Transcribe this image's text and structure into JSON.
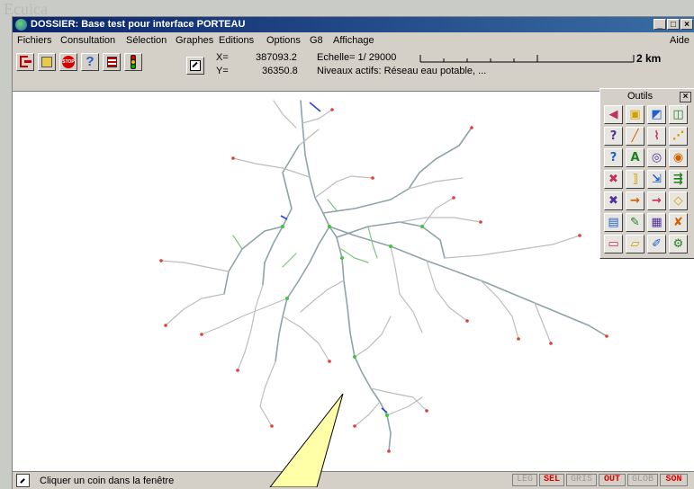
{
  "window": {
    "title": "DOSSIER: Base test pour interface PORTEAU",
    "buttons": [
      "_",
      "□",
      "×"
    ]
  },
  "menu": {
    "items": [
      "Fichiers",
      "Consultation",
      "Sélection",
      "Graphes",
      "Editions",
      "Options",
      "G8",
      "Affichage"
    ],
    "help": "Aide"
  },
  "coords": {
    "x_label": "X=",
    "x_value": "387093.2",
    "y_label": "Y=",
    "y_value": "36350.8"
  },
  "scale": {
    "label": "Echelle= 1/ 29000",
    "levels": "Niveaux actifs:  Réseau eau potable, ...",
    "bar_label": "2 km"
  },
  "tools_panel": {
    "title": "Outils",
    "close": "×"
  },
  "statusbar": {
    "message": "Cliquer un coin dans la fenêtre",
    "buttons": [
      {
        "label": "LEG",
        "state": "inactive"
      },
      {
        "label": "SEL",
        "state": "active"
      },
      {
        "label": "GRIS",
        "state": "inactive"
      },
      {
        "label": "OUT",
        "state": "active"
      },
      {
        "label": "GLOB",
        "state": "inactive"
      },
      {
        "label": "SON",
        "state": "active"
      }
    ]
  },
  "colors": {
    "titlebar": "#0a246a",
    "active_status": "#e00000",
    "inactive_status": "#9a9a9a",
    "network": "#8c9aa0",
    "callout": "#ffffa8"
  }
}
